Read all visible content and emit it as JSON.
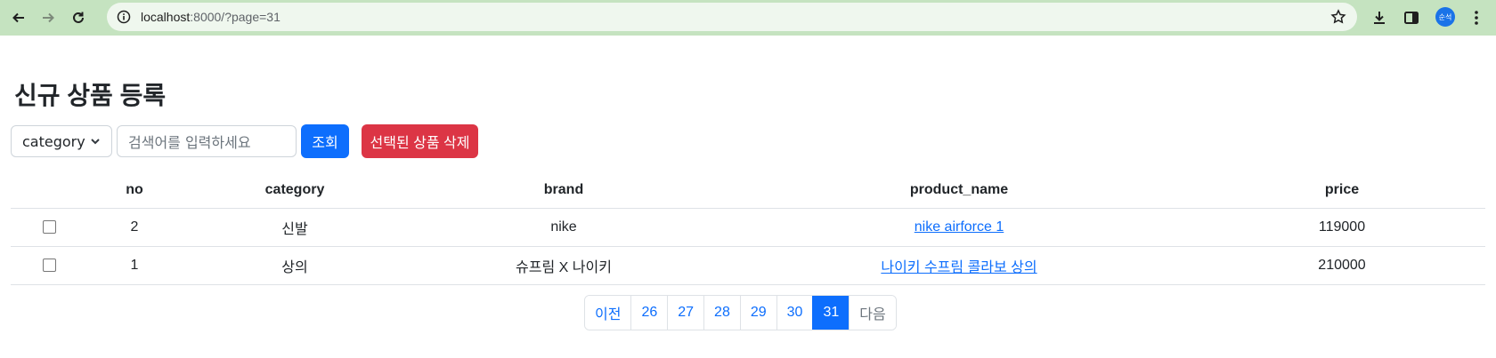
{
  "browser": {
    "url_host": "localhost",
    "url_rest": ":8000/?page=31",
    "avatar_text": "순석"
  },
  "page": {
    "title": "신규 상품 등록"
  },
  "toolbar": {
    "select_value": "category",
    "search_placeholder": "검색어를 입력하세요",
    "search_button": "조회",
    "delete_button": "선택된 상품 삭제"
  },
  "table": {
    "headers": [
      "no",
      "category",
      "brand",
      "product_name",
      "price"
    ],
    "rows": [
      {
        "no": "2",
        "category": "신발",
        "brand": "nike",
        "product_name": "nike airforce 1",
        "price": "119000"
      },
      {
        "no": "1",
        "category": "상의",
        "brand": "슈프림 X 나이키",
        "product_name": "나이키 수프림 콜라보 상의",
        "price": "210000"
      }
    ]
  },
  "pagination": {
    "prev": "이전",
    "pages": [
      "26",
      "27",
      "28",
      "29",
      "30",
      "31"
    ],
    "active": "31",
    "next": "다음"
  }
}
